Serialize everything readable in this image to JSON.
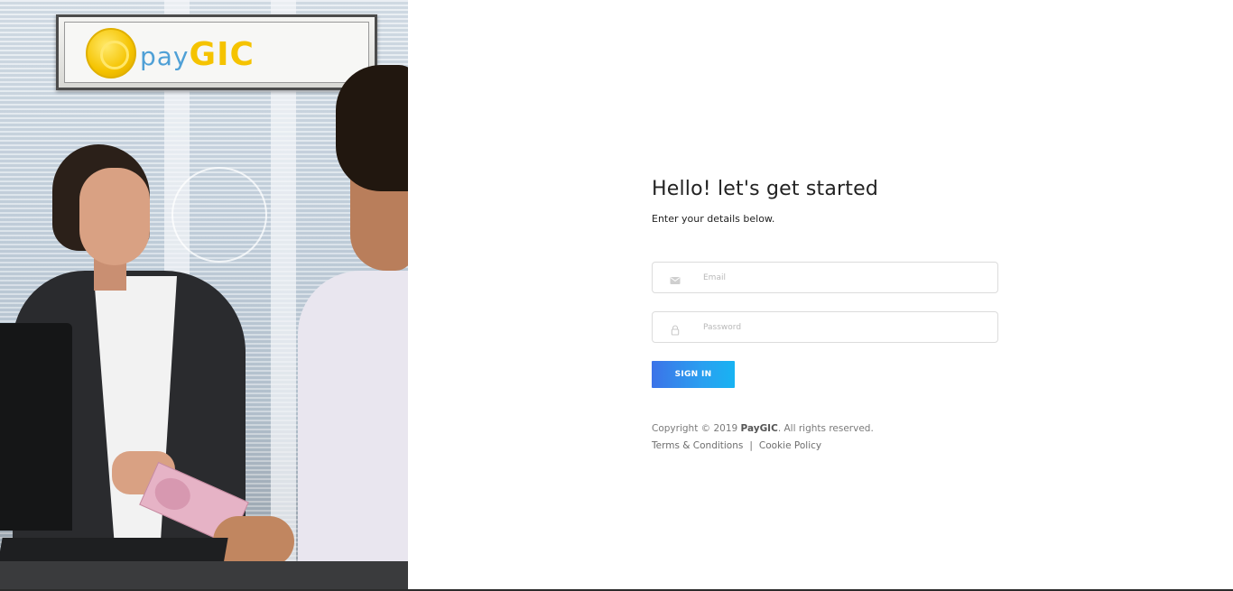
{
  "hero": {
    "brand_pay": "pay",
    "brand_gic": "GIC"
  },
  "login": {
    "heading": "Hello! let's get started",
    "subheading": "Enter your details below.",
    "email_placeholder": "Email",
    "email_value": "",
    "password_placeholder": "Password",
    "password_value": "",
    "signin_label": "SIGN IN",
    "email_icon": "envelope-icon",
    "password_icon": "lock-icon"
  },
  "footer": {
    "copyright_prefix": "Copyright © 2019 ",
    "copyright_brand": "PayGIC",
    "copyright_suffix": ". All rights reserved.",
    "terms_label": "Terms & Conditions",
    "separator": "|",
    "cookie_label": "Cookie Policy"
  },
  "colors": {
    "accent_start": "#3c73e8",
    "accent_end": "#18b3f2",
    "brand_blue": "#4fa0d6",
    "brand_yellow": "#f5c300"
  }
}
